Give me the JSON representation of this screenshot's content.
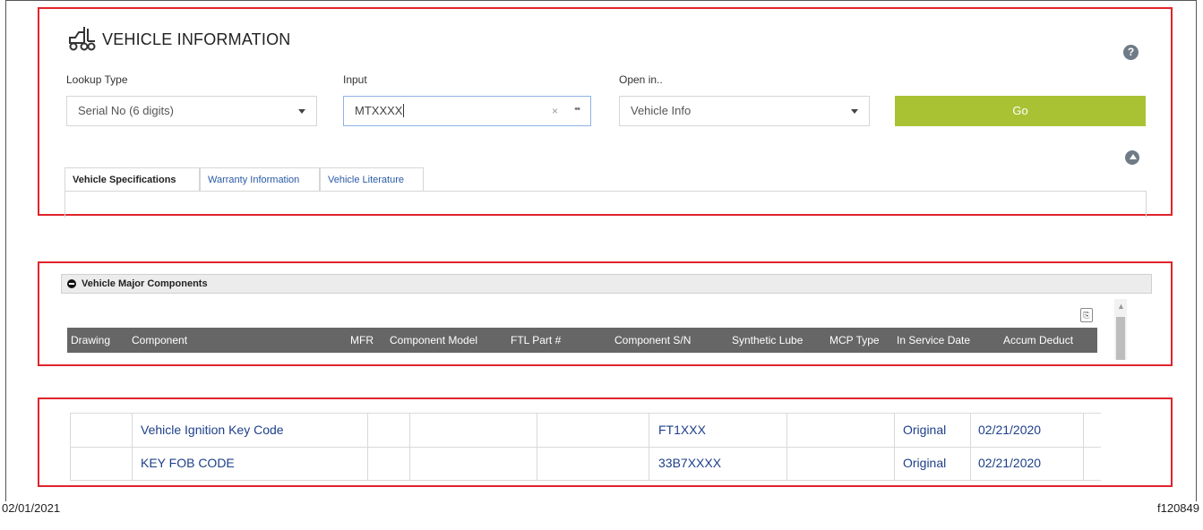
{
  "vehicle_info": {
    "title": "VEHICLE INFORMATION",
    "help_icon": "?",
    "lookup_type_label": "Lookup Type",
    "lookup_type_value": "Serial No (6 digits)",
    "input_label": "Input",
    "input_value": "MTXXXX",
    "clear_icon": "×",
    "more_icon": "••",
    "open_in_label": "Open in..",
    "open_in_value": "Vehicle Info",
    "go_label": "Go",
    "tabs": [
      {
        "label": "Vehicle Specifications"
      },
      {
        "label": "Warranty Information"
      },
      {
        "label": "Vehicle Literature"
      }
    ],
    "colors": {
      "go_button": "#a9c234",
      "border": "#e0242b"
    }
  },
  "major_components": {
    "title": "Vehicle Major Components",
    "export_icon": "⎘",
    "columns": [
      "Drawing",
      "Component",
      "MFR",
      "Component Model",
      "FTL Part #",
      "Component S/N",
      "Synthetic Lube",
      "MCP Type",
      "In Service Date",
      "Accum Deduct"
    ]
  },
  "component_rows": [
    {
      "component": "Vehicle Ignition Key Code",
      "serial": "FT1XXX",
      "mcp_type": "Original",
      "in_service_date": "02/21/2020"
    },
    {
      "component": "KEY FOB CODE",
      "serial": "33B7XXXX",
      "mcp_type": "Original",
      "in_service_date": "02/21/2020"
    }
  ],
  "footer": {
    "date": "02/01/2021",
    "figure_id": "f120849"
  }
}
